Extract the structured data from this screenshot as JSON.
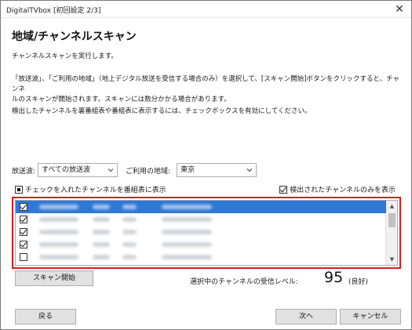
{
  "window": {
    "title": "DigitalTVbox [初回設定 2/3]",
    "close_glyph": "✕"
  },
  "page": {
    "title": "地域/チャンネルスキャン",
    "subtitle": "チャンネルスキャンを実行します。",
    "description_line1": "「放送波」、「ご利用の地域」（地上デジタル放送を受信する場合のみ）を選択して、[スキャン開始]ボタンをクリックすると、チャンネ",
    "description_line2": "ルのスキャンが開始されます。スキャンには数分かかる場合があります。",
    "description2": "検出したチャンネルを裏番組表や番組表に表示するには、チェックボックスを有効にしてください。"
  },
  "filters": {
    "broadcast_label": "放送波:",
    "broadcast_value": "すべての放送波",
    "region_label": "ご利用の地域:",
    "region_value": "東京"
  },
  "options": {
    "show_in_guide_label": "チェックを入れたチャンネルを番組表に表示",
    "show_in_guide_state": "partial",
    "only_detected_label": "検出されたチャンネルのみを表示",
    "only_detected_checked": true
  },
  "channel_list": {
    "rows": [
      {
        "checked": true,
        "selected": true
      },
      {
        "checked": true,
        "selected": false
      },
      {
        "checked": true,
        "selected": false
      },
      {
        "checked": true,
        "selected": false
      },
      {
        "checked": false,
        "selected": false
      }
    ]
  },
  "buttons": {
    "scan": "スキャン開始",
    "back": "戻る",
    "next": "次へ",
    "cancel": "キャンセル"
  },
  "signal": {
    "label": "選択中のチャンネルの受信レベル:",
    "value": "95",
    "quality": "(良好)"
  },
  "icons": {
    "dropdown": "chevron-down-icon",
    "scroll_up": "chevron-up-icon",
    "scroll_down": "chevron-down-icon"
  },
  "colors": {
    "highlight_border": "#e0191e",
    "selected_row": "#2e79d5"
  }
}
